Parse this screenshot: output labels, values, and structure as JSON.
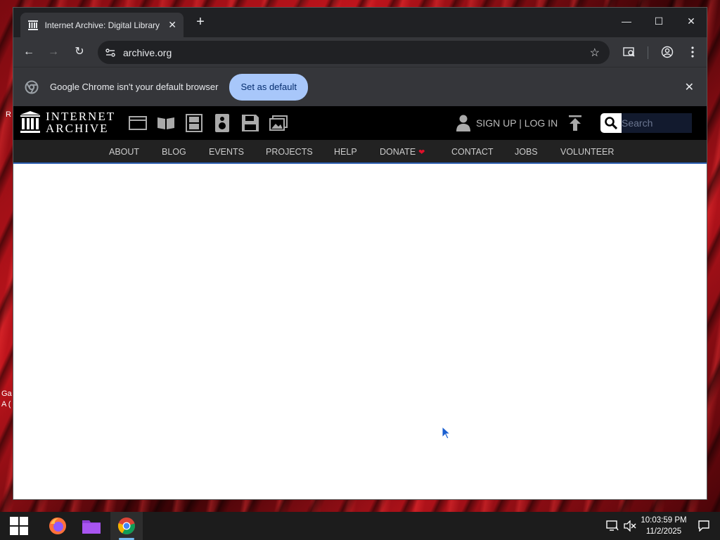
{
  "desktop": {
    "edge_text_1": "R",
    "edge_text_2": "Ga",
    "edge_text_3": "A ("
  },
  "browser": {
    "tab": {
      "title": "Internet Archive: Digital Library",
      "favicon": "archive-columns-icon"
    },
    "new_tab_label": "+",
    "window_controls": {
      "minimize": "—",
      "maximize": "☐",
      "close": "✕"
    },
    "address": {
      "url": "archive.org"
    },
    "infobar": {
      "message": "Google Chrome isn't your default browser",
      "button_label": "Set as default"
    }
  },
  "site": {
    "logo_line1": "INTERNET",
    "logo_line2": "ARCHIVE",
    "media_icons": [
      "web-icon",
      "texts-icon",
      "video-icon",
      "audio-icon",
      "software-icon",
      "images-icon"
    ],
    "auth_label": "SIGN UP | LOG IN",
    "search_placeholder": "Search",
    "nav": [
      "ABOUT",
      "BLOG",
      "EVENTS",
      "PROJECTS",
      "HELP",
      "DONATE",
      "CONTACT",
      "JOBS",
      "VOLUNTEER"
    ]
  },
  "taskbar": {
    "apps": [
      "start-icon",
      "firefox-icon",
      "file-explorer-icon",
      "chrome-icon"
    ],
    "time": "10:03:59 PM",
    "date": "11/2/2025"
  },
  "colors": {
    "accent_blue": "#a8c7fa",
    "ia_black": "#000000",
    "donate_heart": "#e0102a",
    "wallpaper_red": "#c0141c"
  }
}
